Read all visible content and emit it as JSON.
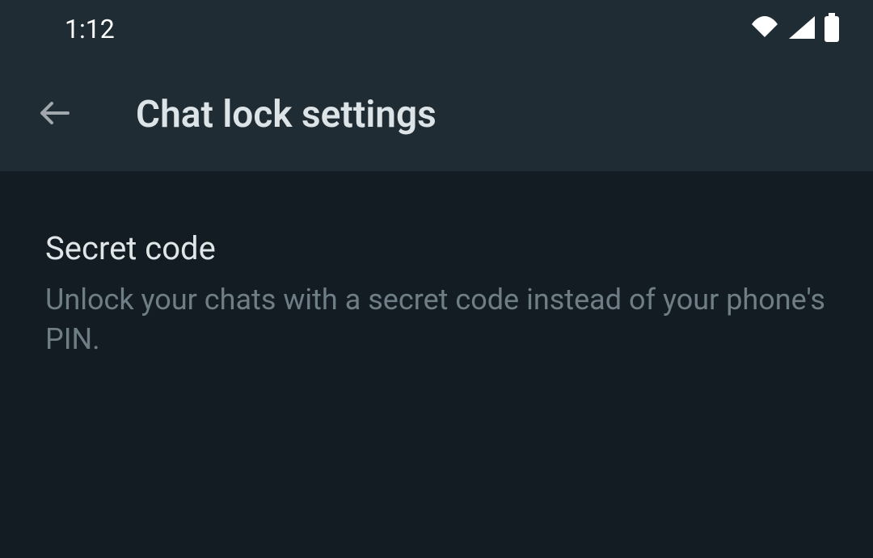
{
  "status_bar": {
    "time": "1:12"
  },
  "app_bar": {
    "title": "Chat lock settings"
  },
  "settings": {
    "secret_code": {
      "title": "Secret code",
      "description": "Unlock your chats with a secret code instead of your phone's PIN."
    }
  }
}
